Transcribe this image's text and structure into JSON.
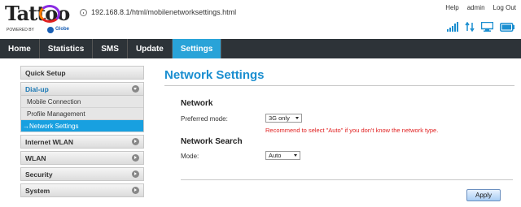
{
  "logo": {
    "brand": "Tattoo",
    "powered_by": "POWERED BY",
    "partner": "Globe"
  },
  "address_bar": {
    "url": "192.168.8.1/html/mobilenetworksettings.html"
  },
  "top_links": {
    "help": "Help",
    "user": "admin",
    "logout": "Log Out"
  },
  "status_icons": [
    "signal-strength-icon",
    "data-transfer-icon",
    "computer-connection-icon",
    "battery-icon"
  ],
  "menu": {
    "items": [
      {
        "label": "Home"
      },
      {
        "label": "Statistics"
      },
      {
        "label": "SMS"
      },
      {
        "label": "Update"
      },
      {
        "label": "Settings",
        "active": true
      }
    ]
  },
  "sidebar": {
    "quick_setup": "Quick Setup",
    "dialup": {
      "label": "Dial-up",
      "items": [
        "Mobile Connection",
        "Profile Management",
        "→Network Settings"
      ]
    },
    "groups": [
      "Internet WLAN",
      "WLAN",
      "Security",
      "System"
    ]
  },
  "main": {
    "title": "Network Settings",
    "network_section": "Network",
    "preferred_mode_label": "Preferred mode:",
    "preferred_mode_value": "3G only",
    "hint": "Recommend to select \"Auto\" if you don't know the network type.",
    "search_section": "Network Search",
    "mode_label": "Mode:",
    "mode_value": "Auto",
    "apply_label": "Apply"
  },
  "colors": {
    "accent": "#29a3d8",
    "menubar": "#2d3338",
    "title": "#1a8ed0",
    "hint": "#e02020"
  }
}
